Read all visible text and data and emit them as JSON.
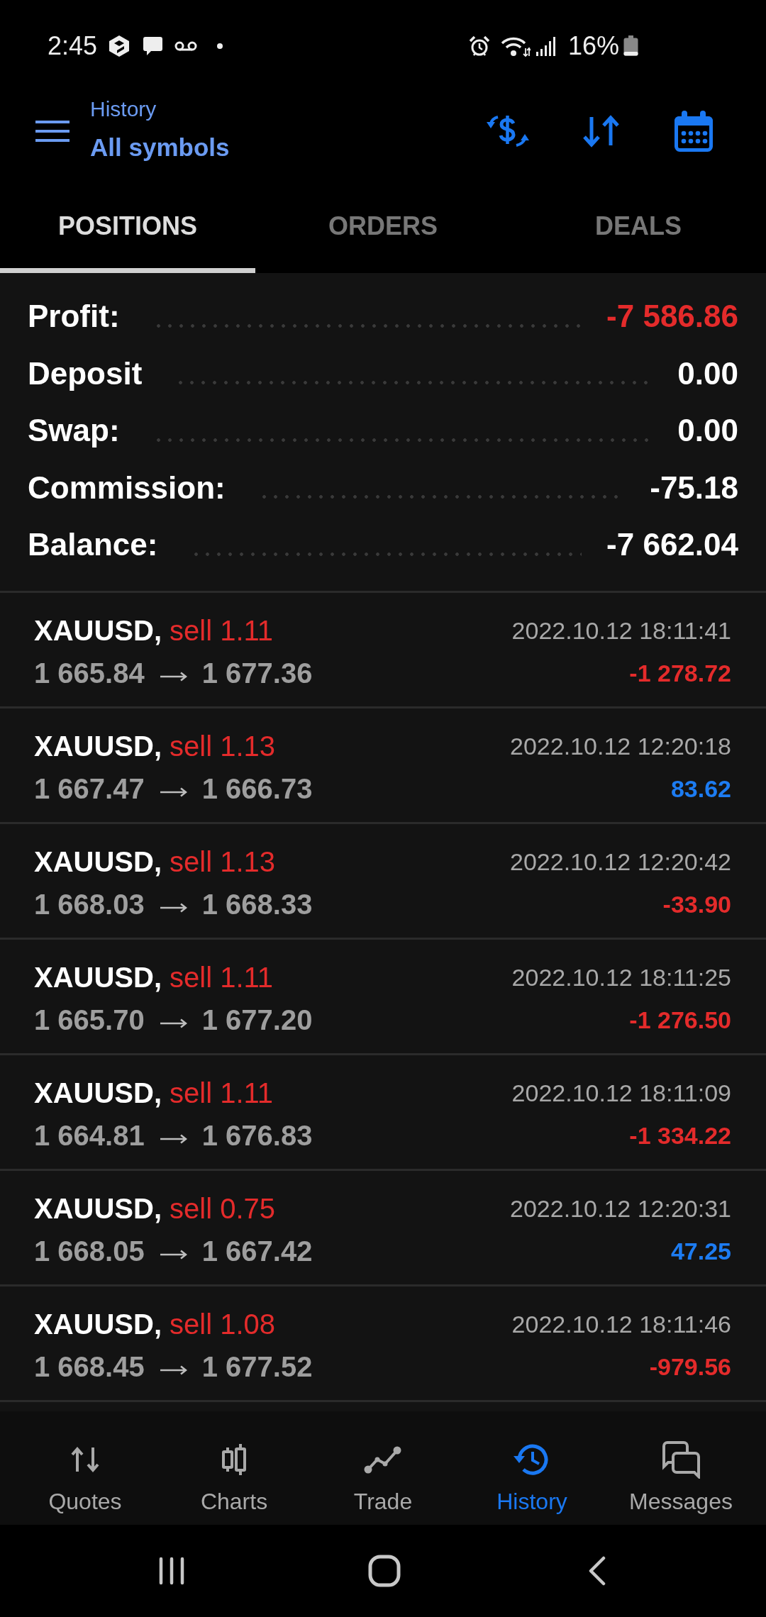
{
  "status_bar": {
    "time": "2:45",
    "battery": "16%"
  },
  "header": {
    "subtitle": "History",
    "title": "All symbols"
  },
  "tabs": [
    {
      "label": "POSITIONS",
      "selected": true
    },
    {
      "label": "ORDERS",
      "selected": false
    },
    {
      "label": "DEALS",
      "selected": false
    }
  ],
  "summary": [
    {
      "label": "Profit:",
      "value": "-7 586.86",
      "color": "#e42b2b"
    },
    {
      "label": "Deposit",
      "value": "0.00",
      "color": "#ffffff"
    },
    {
      "label": "Swap:",
      "value": "0.00",
      "color": "#ffffff"
    },
    {
      "label": "Commission:",
      "value": "-75.18",
      "color": "#ffffff"
    },
    {
      "label": "Balance:",
      "value": "-7 662.04",
      "color": "#ffffff"
    }
  ],
  "positions": [
    {
      "symbol": "XAUUSD,",
      "kind": "sell",
      "order": "sell 1.11",
      "open_price": "1 665.84",
      "close_price": "1 677.36",
      "time": "2022.10.12 18:11:41",
      "profit": "-1 278.72",
      "color": "#e42b2b"
    },
    {
      "symbol": "XAUUSD,",
      "kind": "sell",
      "order": "sell 1.13",
      "open_price": "1 667.47",
      "close_price": "1 666.73",
      "time": "2022.10.12 12:20:18",
      "profit": "83.62",
      "color": "#1d7cf2"
    },
    {
      "symbol": "XAUUSD,",
      "kind": "sell",
      "order": "sell 1.13",
      "open_price": "1 668.03",
      "close_price": "1 668.33",
      "time": "2022.10.12 12:20:42",
      "profit": "-33.90",
      "color": "#e42b2b"
    },
    {
      "symbol": "XAUUSD,",
      "kind": "sell",
      "order": "sell 1.11",
      "open_price": "1 665.70",
      "close_price": "1 677.20",
      "time": "2022.10.12 18:11:25",
      "profit": "-1 276.50",
      "color": "#e42b2b"
    },
    {
      "symbol": "XAUUSD,",
      "kind": "sell",
      "order": "sell 1.11",
      "open_price": "1 664.81",
      "close_price": "1 676.83",
      "time": "2022.10.12 18:11:09",
      "profit": "-1 334.22",
      "color": "#e42b2b"
    },
    {
      "symbol": "XAUUSD,",
      "kind": "sell",
      "order": "sell 0.75",
      "open_price": "1 668.05",
      "close_price": "1 667.42",
      "time": "2022.10.12 12:20:31",
      "profit": "47.25",
      "color": "#1d7cf2"
    },
    {
      "symbol": "XAUUSD,",
      "kind": "sell",
      "order": "sell 1.08",
      "open_price": "1 668.45",
      "close_price": "1 677.52",
      "time": "2022.10.12 18:11:46",
      "profit": "-979.56",
      "color": "#e42b2b"
    }
  ],
  "bottom_nav": [
    {
      "label": "Quotes",
      "selected": false
    },
    {
      "label": "Charts",
      "selected": false
    },
    {
      "label": "Trade",
      "selected": false
    },
    {
      "label": "History",
      "selected": true
    },
    {
      "label": "Messages",
      "selected": false
    }
  ]
}
